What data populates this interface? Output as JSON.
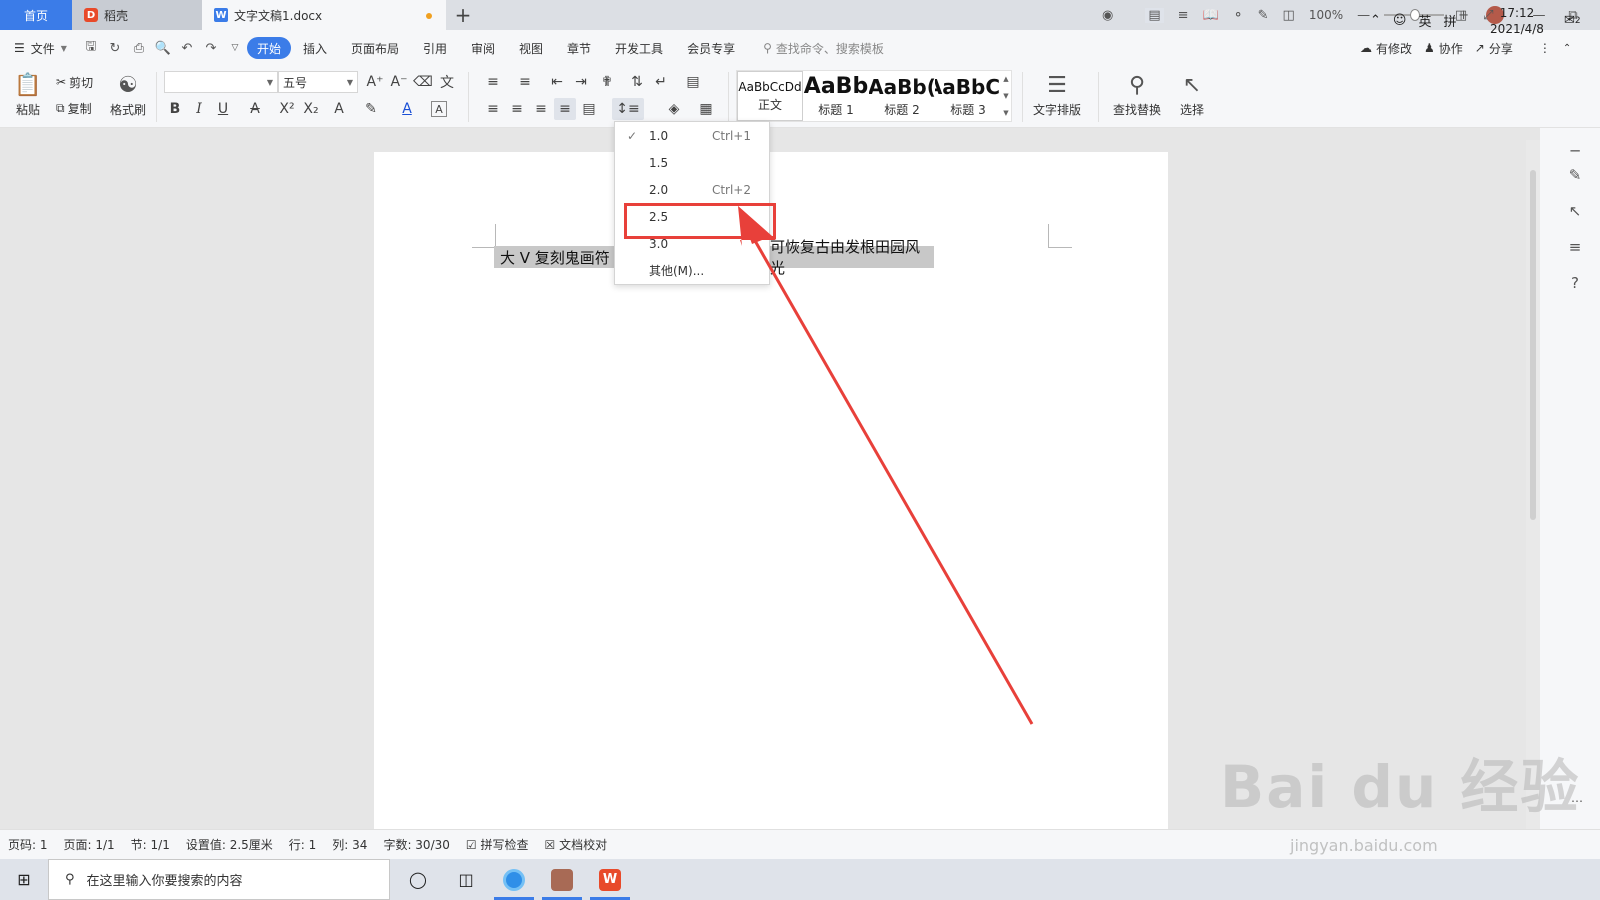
{
  "tabs": {
    "home": "首页",
    "daoke": "稻壳",
    "doc": "文字文稿1.docx",
    "add": "+"
  },
  "menu": {
    "file": "文件",
    "items": [
      "开始",
      "插入",
      "页面布局",
      "引用",
      "审阅",
      "视图",
      "章节",
      "开发工具",
      "会员专享"
    ],
    "search_placeholder": "查找命令、搜索模板",
    "right": [
      "有修改",
      "协作",
      "分享"
    ]
  },
  "ribbon": {
    "paste": "粘贴",
    "cut": "剪切",
    "copy": "复制",
    "format_painter": "格式刷",
    "font_name": "",
    "font_size": "五号",
    "styles": [
      {
        "preview": "AaBbCcDd",
        "name": "正文"
      },
      {
        "preview": "AaBb",
        "name": "标题 1"
      },
      {
        "preview": "AaBb(",
        "name": "标题 2"
      },
      {
        "preview": "AaBbC(",
        "name": "标题 3"
      }
    ],
    "text_layout": "文字排版",
    "find_replace": "查找替换",
    "select": "选择"
  },
  "document": {
    "text_left": "大 V 复刻鬼画符 IE",
    "text_right": "可恢复古由发根田园风光"
  },
  "line_spacing_menu": {
    "items": [
      {
        "label": "1.0",
        "shortcut": "Ctrl+1",
        "checked": true
      },
      {
        "label": "1.5",
        "shortcut": "",
        "checked": false
      },
      {
        "label": "2.0",
        "shortcut": "Ctrl+2",
        "checked": false
      },
      {
        "label": "2.5",
        "shortcut": "",
        "checked": false
      },
      {
        "label": "3.0",
        "shortcut": "",
        "checked": false
      },
      {
        "label": "其他(M)...",
        "shortcut": "",
        "checked": false
      }
    ],
    "highlighted": "2.5",
    "highlight_color": "#e8403a"
  },
  "status": {
    "page_code": "页码: 1",
    "pages": "页面: 1/1",
    "section": "节: 1/1",
    "setting": "设置值: 2.5厘米",
    "row": "行: 1",
    "col": "列: 34",
    "words": "字数: 30/30",
    "spell": "拼写检查",
    "proof": "文档校对",
    "zoom": "100%"
  },
  "taskbar": {
    "search_placeholder": "在这里输入你要搜索的内容",
    "lang": "英",
    "ime": "拼",
    "time": "17:12",
    "date": "2021/4/8",
    "notifications": "2"
  },
  "watermark": {
    "text": "Bai du 经验",
    "url": "jingyan.baidu.com"
  },
  "colors": {
    "accent": "#3b7ce8",
    "red_box": "#e8403a",
    "arrow": "#e8403a"
  }
}
